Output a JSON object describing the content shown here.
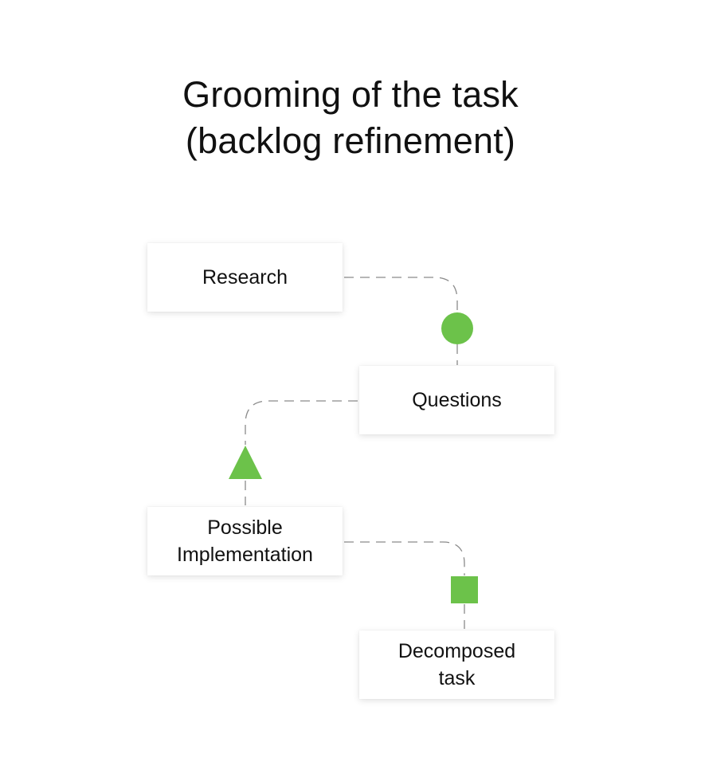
{
  "title": {
    "line1": "Grooming of the task",
    "line2": "(backlog refinement)"
  },
  "steps": [
    {
      "label": "Research",
      "marker": "green-circle"
    },
    {
      "label": "Questions",
      "marker": "green-triangle"
    },
    {
      "label_line1": "Possible",
      "label_line2": "Implementation",
      "marker": "green-square"
    },
    {
      "label_line1": "Decomposed",
      "label_line2": "task"
    }
  ],
  "colors": {
    "marker_green": "#6cc24a",
    "connector": "#8a8a8a",
    "text": "#111111"
  }
}
